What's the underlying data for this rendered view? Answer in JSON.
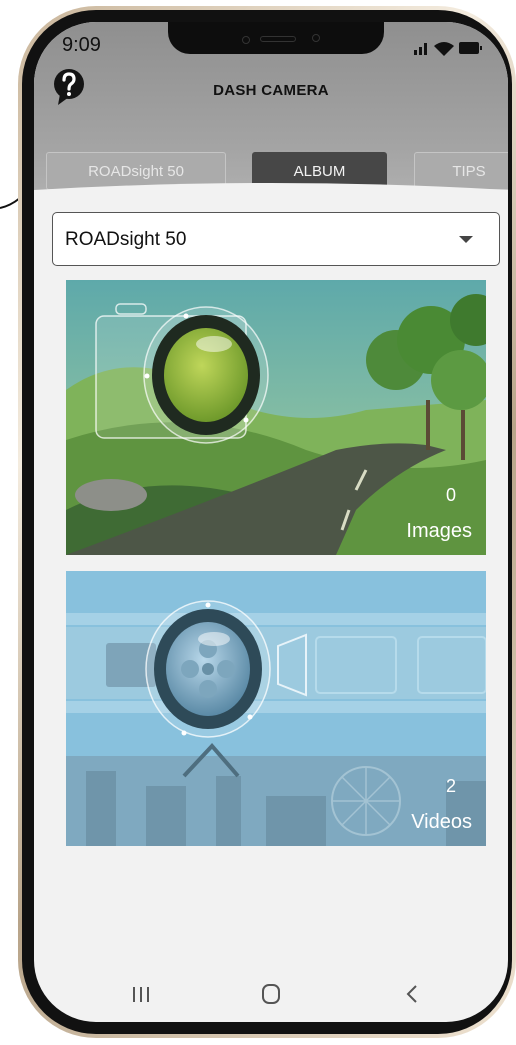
{
  "status_bar": {
    "time": "9:09"
  },
  "app": {
    "title": "DASH CAMERA"
  },
  "tabs": [
    {
      "label": "ROADsight 50",
      "active": false
    },
    {
      "label": "ALBUM",
      "active": true
    },
    {
      "label": "TIPS",
      "active": false
    }
  ],
  "device_selector": {
    "value": "ROADsight 50"
  },
  "album": {
    "images": {
      "count": "0",
      "label": "Images"
    },
    "videos": {
      "count": "2",
      "label": "Videos"
    }
  },
  "nav": {
    "recents": "recents-icon",
    "home": "home-icon",
    "back": "back-icon"
  },
  "colors": {
    "header": "#9b9b9b",
    "active_tab": "#474747",
    "inactive_tab": "#ababab",
    "video_card": "#88c1dd",
    "image_card_road": "#4f5a45"
  }
}
